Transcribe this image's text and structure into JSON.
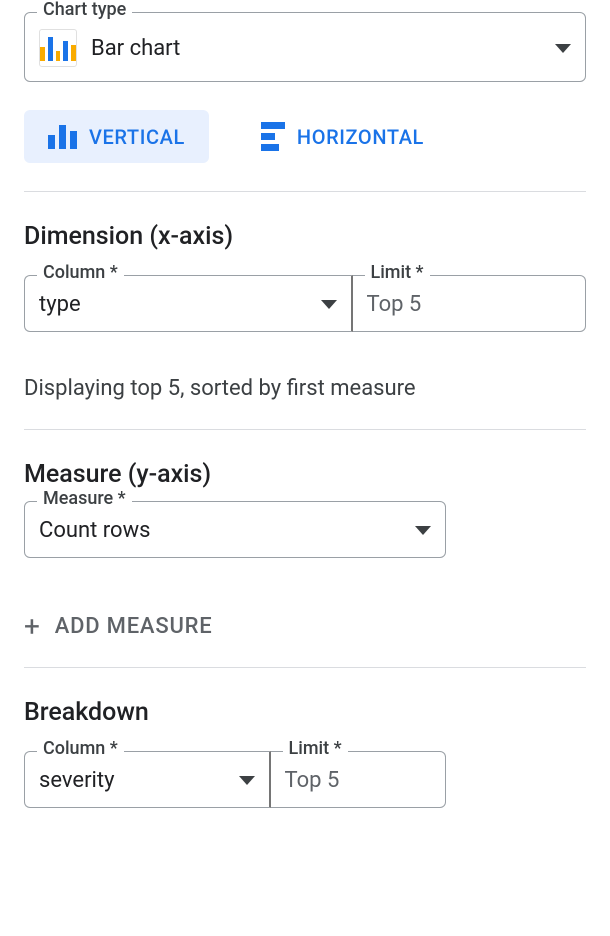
{
  "chart_type": {
    "legend": "Chart type",
    "value": "Bar chart"
  },
  "tabs": {
    "vertical": "VERTICAL",
    "horizontal": "HORIZONTAL"
  },
  "dimension": {
    "title": "Dimension (x-axis)",
    "column_legend": "Column *",
    "column_value": "type",
    "limit_legend": "Limit *",
    "limit_value": "Top 5",
    "hint": "Displaying top 5, sorted by first measure"
  },
  "measure": {
    "title": "Measure (y-axis)",
    "legend": "Measure *",
    "value": "Count rows",
    "add_label": "ADD MEASURE"
  },
  "breakdown": {
    "title": "Breakdown",
    "column_legend": "Column *",
    "column_value": "severity",
    "limit_legend": "Limit *",
    "limit_value": "Top 5"
  }
}
